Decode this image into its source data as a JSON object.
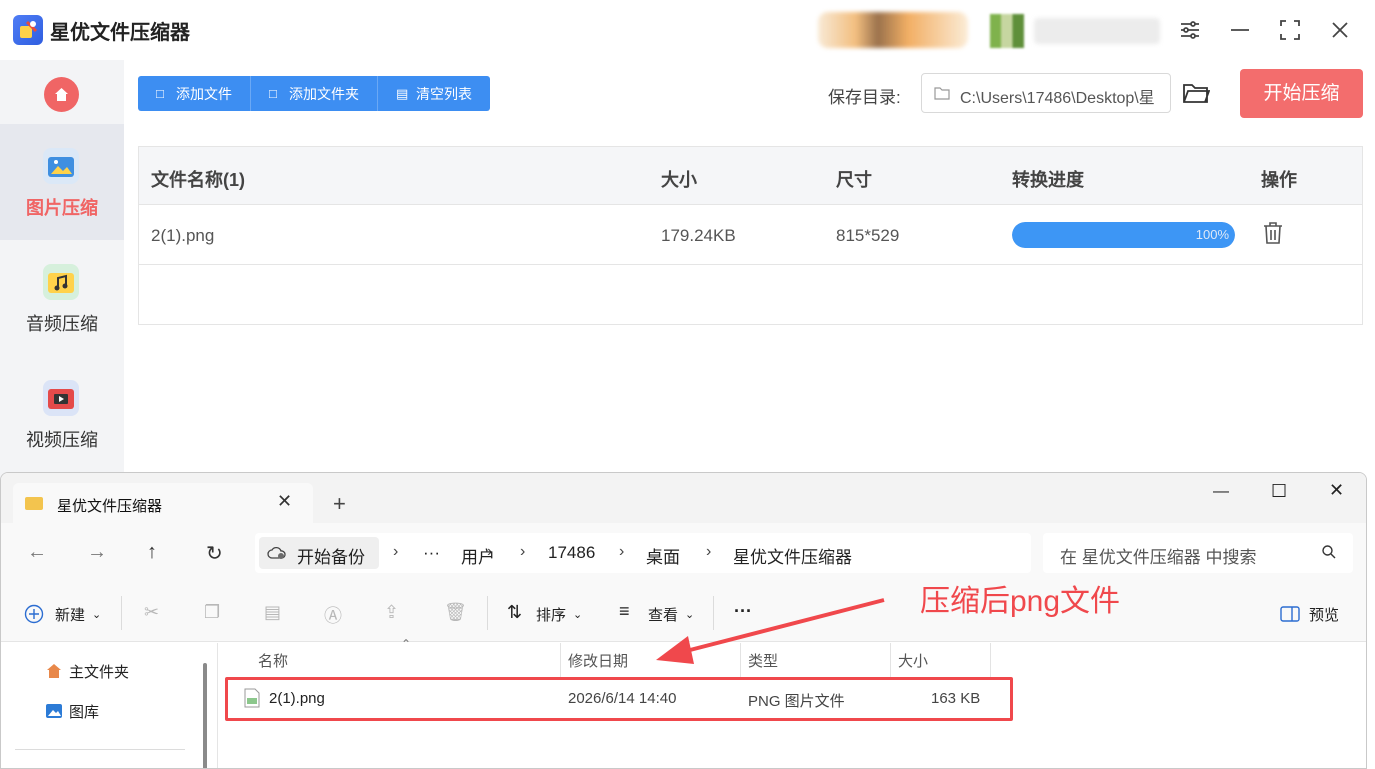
{
  "app": {
    "title": "星优文件压缩器",
    "sidebar": [
      {
        "label": "图片压缩",
        "active": true,
        "icon": "image-icon"
      },
      {
        "label": "音频压缩",
        "active": false,
        "icon": "music-icon"
      },
      {
        "label": "视频压缩",
        "active": false,
        "icon": "video-icon"
      }
    ],
    "toolbar": {
      "add_file": "添加文件",
      "add_folder": "添加文件夹",
      "clear_list": "清空列表"
    },
    "save": {
      "label": "保存目录:",
      "path": "C:\\Users\\17486\\Desktop\\星"
    },
    "start_button": "开始压缩",
    "table": {
      "headers": [
        "文件名称(1)",
        "大小",
        "尺寸",
        "转换进度",
        "操作"
      ],
      "rows": [
        {
          "name": "2(1).png",
          "size": "179.24KB",
          "dimensions": "815*529",
          "progress": 100,
          "progress_label": "100%"
        }
      ]
    },
    "colors": {
      "accent": "#3d8ef2",
      "danger": "#f36d6d"
    }
  },
  "explorer": {
    "tab_title": "星优文件压缩器",
    "breadcrumbs": [
      "开始备份",
      "···",
      "用户",
      "17486",
      "桌面",
      "星优文件压缩器"
    ],
    "search_placeholder": "在 星优文件压缩器 中搜索",
    "commands": {
      "new": "新建",
      "sort": "排序",
      "view": "查看",
      "more": "···",
      "preview": "预览"
    },
    "nav": [
      {
        "label": "主文件夹",
        "icon": "home-icon"
      },
      {
        "label": "图库",
        "icon": "gallery-icon"
      }
    ],
    "columns": [
      "名称",
      "修改日期",
      "类型",
      "大小"
    ],
    "files": [
      {
        "name": "2(1).png",
        "modified": "2026/6/14 14:40",
        "type": "PNG 图片文件",
        "size": "163 KB"
      }
    ]
  },
  "annotation": {
    "text": "压缩后png文件",
    "color": "#f0484c"
  }
}
